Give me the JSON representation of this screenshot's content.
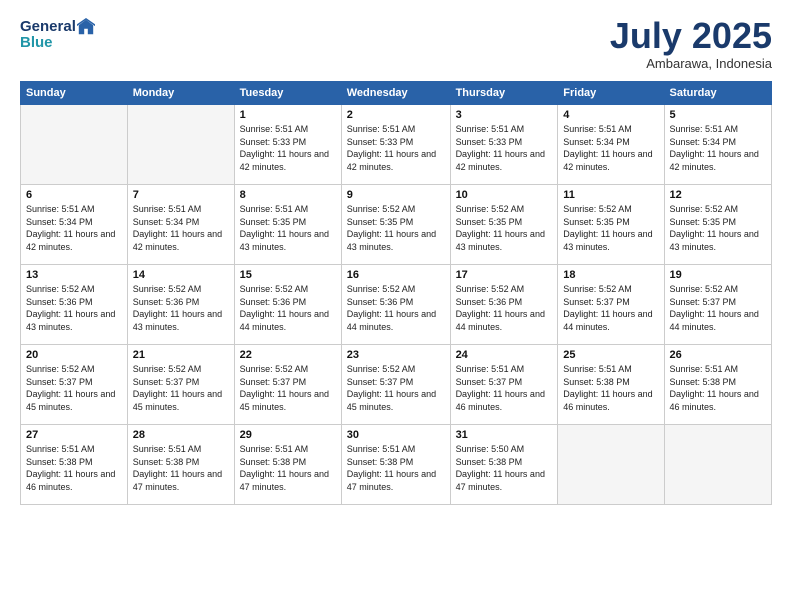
{
  "header": {
    "logo_line1": "General",
    "logo_line2": "Blue",
    "month": "July 2025",
    "location": "Ambarawa, Indonesia"
  },
  "weekdays": [
    "Sunday",
    "Monday",
    "Tuesday",
    "Wednesday",
    "Thursday",
    "Friday",
    "Saturday"
  ],
  "weeks": [
    [
      {
        "day": "",
        "info": ""
      },
      {
        "day": "",
        "info": ""
      },
      {
        "day": "1",
        "info": "Sunrise: 5:51 AM\nSunset: 5:33 PM\nDaylight: 11 hours and 42 minutes."
      },
      {
        "day": "2",
        "info": "Sunrise: 5:51 AM\nSunset: 5:33 PM\nDaylight: 11 hours and 42 minutes."
      },
      {
        "day": "3",
        "info": "Sunrise: 5:51 AM\nSunset: 5:33 PM\nDaylight: 11 hours and 42 minutes."
      },
      {
        "day": "4",
        "info": "Sunrise: 5:51 AM\nSunset: 5:34 PM\nDaylight: 11 hours and 42 minutes."
      },
      {
        "day": "5",
        "info": "Sunrise: 5:51 AM\nSunset: 5:34 PM\nDaylight: 11 hours and 42 minutes."
      }
    ],
    [
      {
        "day": "6",
        "info": "Sunrise: 5:51 AM\nSunset: 5:34 PM\nDaylight: 11 hours and 42 minutes."
      },
      {
        "day": "7",
        "info": "Sunrise: 5:51 AM\nSunset: 5:34 PM\nDaylight: 11 hours and 42 minutes."
      },
      {
        "day": "8",
        "info": "Sunrise: 5:51 AM\nSunset: 5:35 PM\nDaylight: 11 hours and 43 minutes."
      },
      {
        "day": "9",
        "info": "Sunrise: 5:52 AM\nSunset: 5:35 PM\nDaylight: 11 hours and 43 minutes."
      },
      {
        "day": "10",
        "info": "Sunrise: 5:52 AM\nSunset: 5:35 PM\nDaylight: 11 hours and 43 minutes."
      },
      {
        "day": "11",
        "info": "Sunrise: 5:52 AM\nSunset: 5:35 PM\nDaylight: 11 hours and 43 minutes."
      },
      {
        "day": "12",
        "info": "Sunrise: 5:52 AM\nSunset: 5:35 PM\nDaylight: 11 hours and 43 minutes."
      }
    ],
    [
      {
        "day": "13",
        "info": "Sunrise: 5:52 AM\nSunset: 5:36 PM\nDaylight: 11 hours and 43 minutes."
      },
      {
        "day": "14",
        "info": "Sunrise: 5:52 AM\nSunset: 5:36 PM\nDaylight: 11 hours and 43 minutes."
      },
      {
        "day": "15",
        "info": "Sunrise: 5:52 AM\nSunset: 5:36 PM\nDaylight: 11 hours and 44 minutes."
      },
      {
        "day": "16",
        "info": "Sunrise: 5:52 AM\nSunset: 5:36 PM\nDaylight: 11 hours and 44 minutes."
      },
      {
        "day": "17",
        "info": "Sunrise: 5:52 AM\nSunset: 5:36 PM\nDaylight: 11 hours and 44 minutes."
      },
      {
        "day": "18",
        "info": "Sunrise: 5:52 AM\nSunset: 5:37 PM\nDaylight: 11 hours and 44 minutes."
      },
      {
        "day": "19",
        "info": "Sunrise: 5:52 AM\nSunset: 5:37 PM\nDaylight: 11 hours and 44 minutes."
      }
    ],
    [
      {
        "day": "20",
        "info": "Sunrise: 5:52 AM\nSunset: 5:37 PM\nDaylight: 11 hours and 45 minutes."
      },
      {
        "day": "21",
        "info": "Sunrise: 5:52 AM\nSunset: 5:37 PM\nDaylight: 11 hours and 45 minutes."
      },
      {
        "day": "22",
        "info": "Sunrise: 5:52 AM\nSunset: 5:37 PM\nDaylight: 11 hours and 45 minutes."
      },
      {
        "day": "23",
        "info": "Sunrise: 5:52 AM\nSunset: 5:37 PM\nDaylight: 11 hours and 45 minutes."
      },
      {
        "day": "24",
        "info": "Sunrise: 5:51 AM\nSunset: 5:37 PM\nDaylight: 11 hours and 46 minutes."
      },
      {
        "day": "25",
        "info": "Sunrise: 5:51 AM\nSunset: 5:38 PM\nDaylight: 11 hours and 46 minutes."
      },
      {
        "day": "26",
        "info": "Sunrise: 5:51 AM\nSunset: 5:38 PM\nDaylight: 11 hours and 46 minutes."
      }
    ],
    [
      {
        "day": "27",
        "info": "Sunrise: 5:51 AM\nSunset: 5:38 PM\nDaylight: 11 hours and 46 minutes."
      },
      {
        "day": "28",
        "info": "Sunrise: 5:51 AM\nSunset: 5:38 PM\nDaylight: 11 hours and 47 minutes."
      },
      {
        "day": "29",
        "info": "Sunrise: 5:51 AM\nSunset: 5:38 PM\nDaylight: 11 hours and 47 minutes."
      },
      {
        "day": "30",
        "info": "Sunrise: 5:51 AM\nSunset: 5:38 PM\nDaylight: 11 hours and 47 minutes."
      },
      {
        "day": "31",
        "info": "Sunrise: 5:50 AM\nSunset: 5:38 PM\nDaylight: 11 hours and 47 minutes."
      },
      {
        "day": "",
        "info": ""
      },
      {
        "day": "",
        "info": ""
      }
    ]
  ]
}
